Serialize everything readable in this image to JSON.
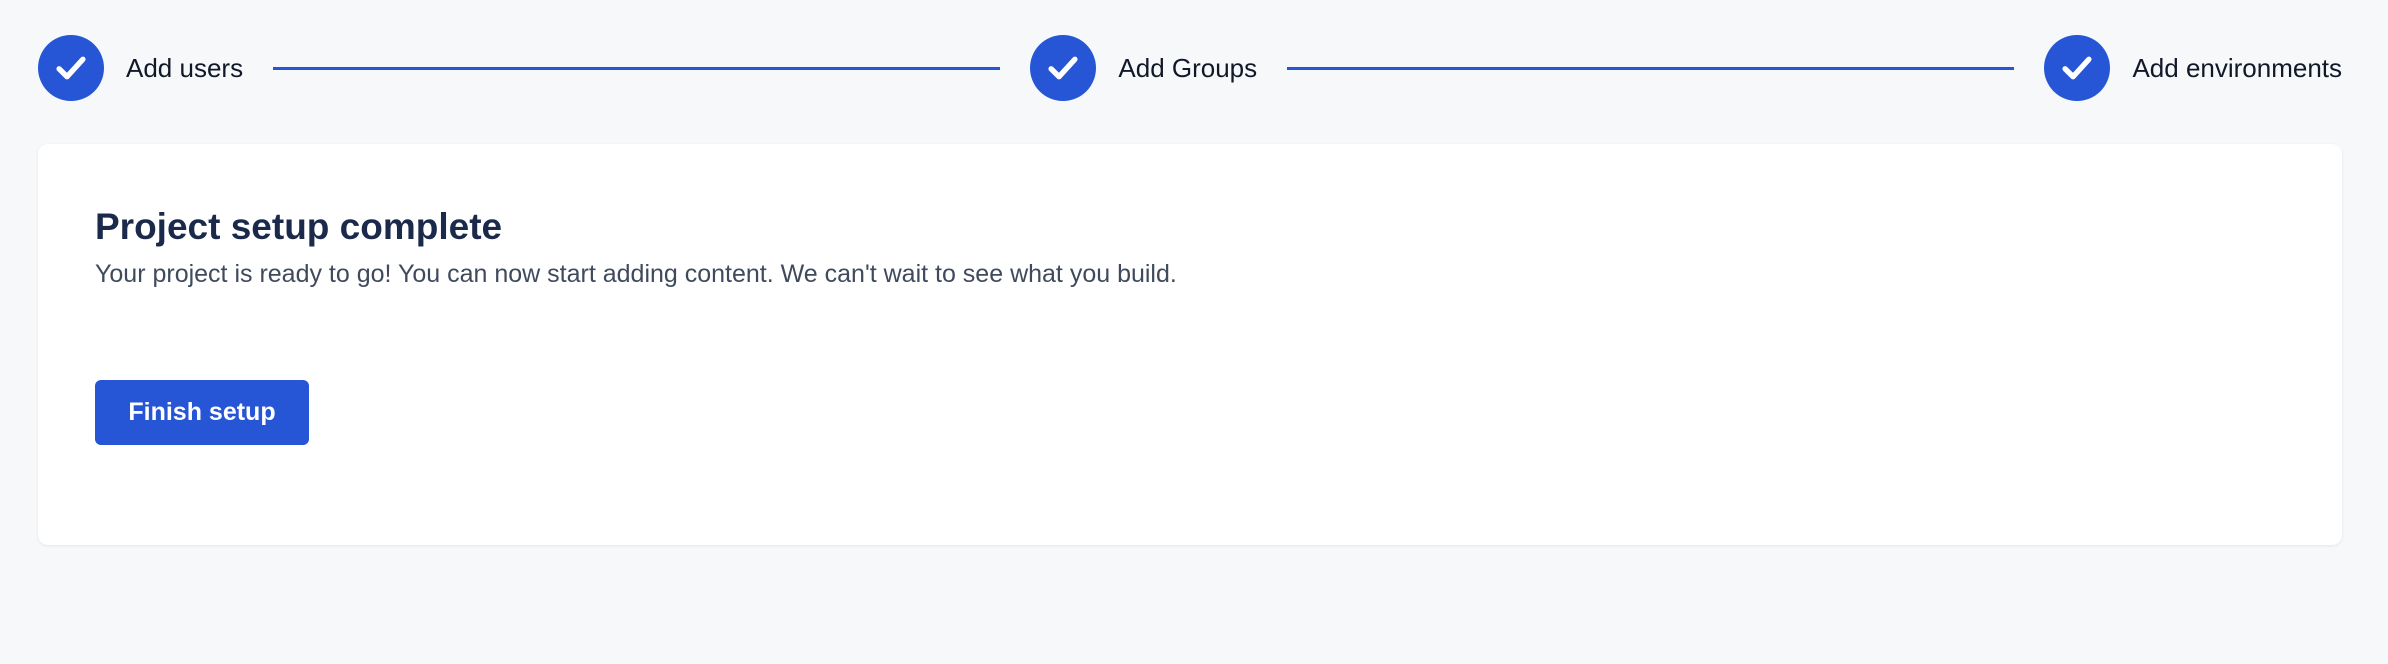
{
  "stepper": {
    "steps": [
      {
        "label": "Add users",
        "status": "complete",
        "icon": "check-icon"
      },
      {
        "label": "Add Groups",
        "status": "complete",
        "icon": "check-icon"
      },
      {
        "label": "Add environments",
        "status": "complete",
        "icon": "check-icon"
      }
    ],
    "accent_color": "#2656d6"
  },
  "card": {
    "title": "Project setup complete",
    "description": "Your project is ready to go! You can now start adding content. We can't wait to see what you build.",
    "finish_button_label": "Finish setup"
  }
}
